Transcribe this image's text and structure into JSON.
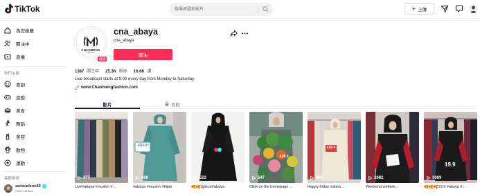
{
  "header": {
    "logo_text": "TikTok",
    "search_placeholder": "搜尋帳號和影片",
    "upload_label": "上傳"
  },
  "sidebar": {
    "nav": [
      {
        "label": "為您推薦",
        "icon": "home-icon"
      },
      {
        "label": "關注中",
        "icon": "following-icon"
      },
      {
        "label": "直播",
        "icon": "live-icon"
      }
    ],
    "topics_heading": "熱門主題",
    "topics": [
      {
        "label": "喜劇",
        "icon": "comedy-icon"
      },
      {
        "label": "遊戲",
        "icon": "gaming-icon"
      },
      {
        "label": "美食",
        "icon": "food-icon"
      },
      {
        "label": "舞蹈",
        "icon": "dance-icon"
      },
      {
        "label": "美容",
        "icon": "beauty-icon"
      },
      {
        "label": "動物",
        "icon": "animals-icon"
      },
      {
        "label": "運動",
        "icon": "sports-icon"
      }
    ],
    "suggested_heading": "客觀帳號",
    "account": {
      "name": "samcarlson33",
      "sub": "Sam Carlson"
    }
  },
  "profile": {
    "username": "cna_abaya",
    "nickname": "cna_abaya",
    "follow_label": "關注",
    "live_badge": "直播",
    "avatar_text": "CHAOMENG",
    "avatar_subtext": "FASHION",
    "stats": [
      {
        "value": "1387",
        "label": "關注中"
      },
      {
        "value": "25.3K",
        "label": "粉絲"
      },
      {
        "value": "16.6K",
        "label": "讚"
      }
    ],
    "bio": "Live broadcast starts at 9:00 every day from Monday to Saturday.",
    "link": "www.Chaomengfashion.com"
  },
  "tabs": {
    "videos": "影片",
    "liked": "喜歡"
  },
  "videos": [
    {
      "views": "377",
      "caption": "Live#abaya #muslim #..."
    },
    {
      "views": "668",
      "caption": "#abaya #muslim #hijab"
    },
    {
      "views": "522",
      "caption": "🥰🥰3piece#abaya"
    },
    {
      "views": "547",
      "caption": "Click on the homepage ..."
    },
    {
      "views": "885",
      "caption": "Happy friday sisters..."
    },
    {
      "views": "2682",
      "caption": "Weekend welfare..."
    },
    {
      "views": "3069",
      "caption": "🥰🥰🥰19.9 #abaya #..."
    }
  ],
  "thumb_overlays": {
    "price_tag_1": "£51.6",
    "price_tag_2": "£29.9",
    "sign_text": "19.9",
    "banner_text": "€25.9"
  },
  "colors": {
    "brand": "#fe2c55",
    "text": "#161823",
    "muted": "#8a8b91"
  }
}
